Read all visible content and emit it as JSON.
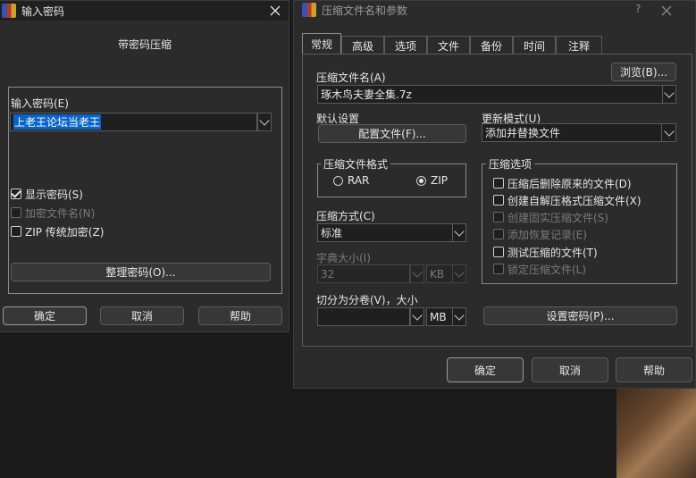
{
  "left_dialog": {
    "title": "输入密码",
    "subtitle": "带密码压缩",
    "password_label": "输入密码(E)",
    "password_value": "上老王论坛当老王",
    "show_password": "显示密码(S)",
    "encrypt_names": "加密文件名(N)",
    "zip_legacy": "ZIP 传统加密(Z)",
    "organize_button": "整理密码(O)...",
    "ok": "确定",
    "cancel": "取消",
    "help": "帮助"
  },
  "right_dialog": {
    "title": "压缩文件名和参数",
    "help_glyph": "?",
    "tabs": [
      "常规",
      "高级",
      "选项",
      "文件",
      "备份",
      "时间",
      "注释"
    ],
    "archive_name_label": "压缩文件名(A)",
    "browse_button": "浏览(B)...",
    "archive_name_value": "琢木鸟夫妻全集.7z",
    "default_settings_label": "默认设置",
    "profiles_button": "配置文件(F)...",
    "update_mode_label": "更新模式(U)",
    "update_mode_value": "添加并替换文件",
    "format_group_label": "压缩文件格式",
    "format_rar": "RAR",
    "format_zip": "ZIP",
    "options_group_label": "压缩选项",
    "options": [
      {
        "label": "压缩后删除原来的文件(D)",
        "disabled": false
      },
      {
        "label": "创建自解压格式压缩文件(X)",
        "disabled": false
      },
      {
        "label": "创建固实压缩文件(S)",
        "disabled": true
      },
      {
        "label": "添加恢复记录(E)",
        "disabled": true
      },
      {
        "label": "测试压缩的文件(T)",
        "disabled": false
      },
      {
        "label": "锁定压缩文件(L)",
        "disabled": true
      }
    ],
    "method_label": "压缩方式(C)",
    "method_value": "标准",
    "dict_label": "字典大小(I)",
    "dict_value": "32",
    "dict_unit": "KB",
    "split_label": "切分为分卷(V)，大小",
    "split_value": "",
    "split_unit": "MB",
    "set_password_button": "设置密码(P)...",
    "ok": "确定",
    "cancel": "取消",
    "help": "帮助"
  }
}
